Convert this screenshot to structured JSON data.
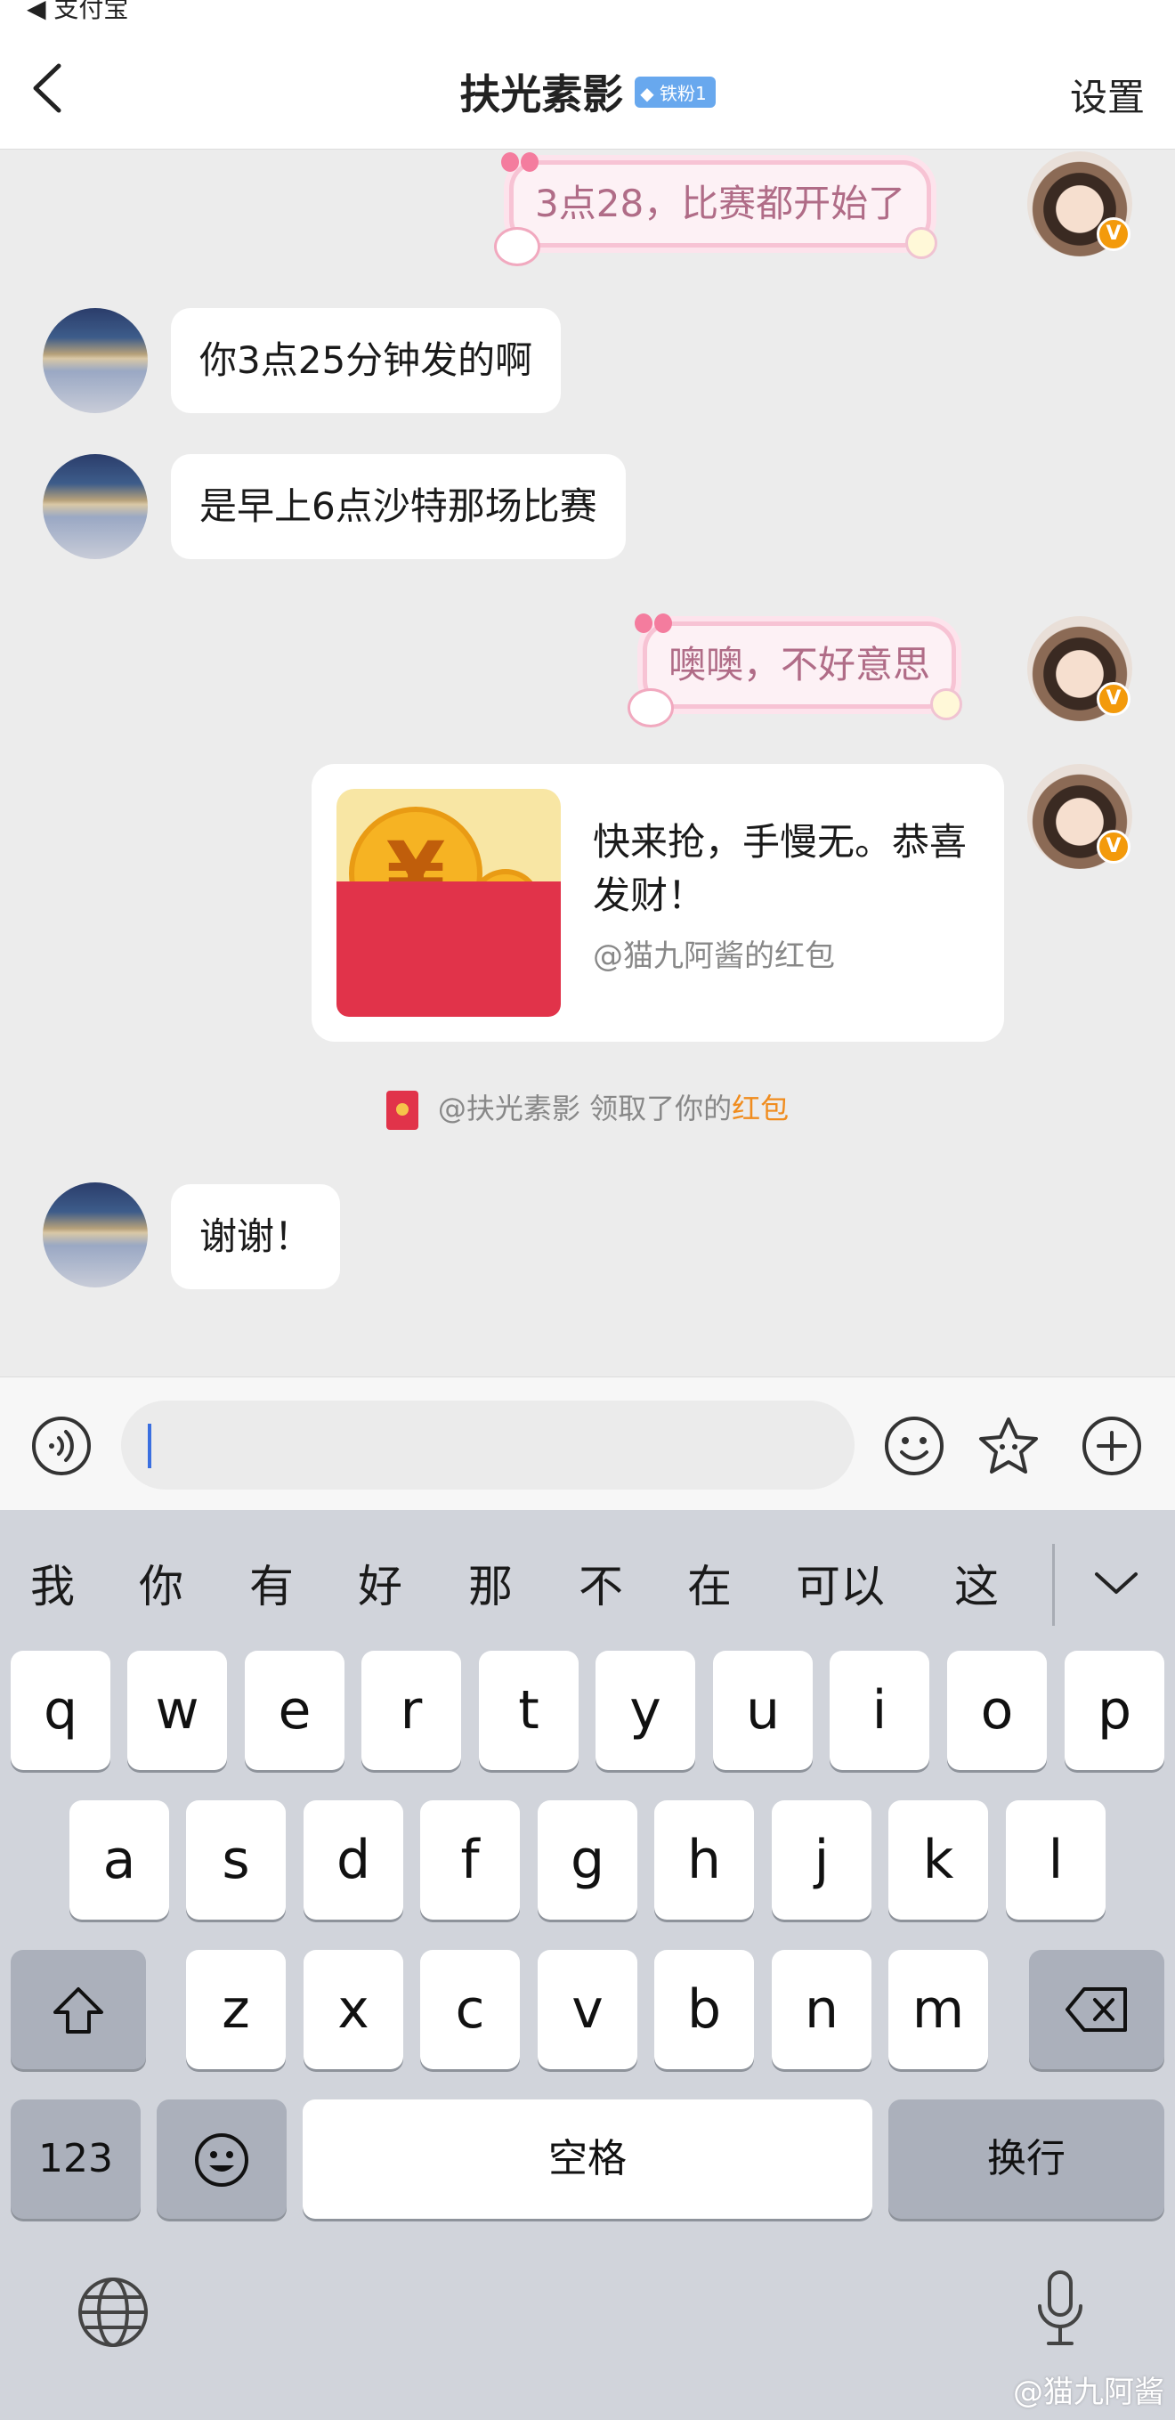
{
  "status": {
    "back_app": "◀ 支付宝"
  },
  "header": {
    "title": "扶光素影",
    "fan_badge": "铁粉1",
    "settings": "设置"
  },
  "messages": {
    "m1": "3点28，比赛都开始了",
    "m2": "你3点25分钟发的啊",
    "m3": "是早上6点沙特那场比赛",
    "m4": "噢噢，不好意思",
    "red_packet": {
      "message": "快来抢，手慢无。恭喜发财！",
      "from": "@猫九阿酱的红包",
      "coin_big": "¥",
      "coin_small": "¥"
    },
    "notice": {
      "text": "@扶光素影 领取了你的",
      "link": "红包"
    },
    "m5": "谢谢！"
  },
  "badges": {
    "verified": "V"
  },
  "keyboard": {
    "candidates": [
      "我",
      "你",
      "有",
      "好",
      "那",
      "不",
      "在",
      "可以",
      "这"
    ],
    "row1": [
      "q",
      "w",
      "e",
      "r",
      "t",
      "y",
      "u",
      "i",
      "o",
      "p"
    ],
    "row2": [
      "a",
      "s",
      "d",
      "f",
      "g",
      "h",
      "j",
      "k",
      "l"
    ],
    "row3": [
      "z",
      "x",
      "c",
      "v",
      "b",
      "n",
      "m"
    ],
    "num_key": "123",
    "space": "空格",
    "return": "换行"
  },
  "watermark": "@猫九阿酱",
  "colors": {
    "accent_orange": "#f08c1e",
    "red_packet": "#e1334a",
    "caret": "#3a6fe0"
  },
  "icons": [
    "back-icon",
    "voice-icon",
    "emoji-icon",
    "sticker-icon",
    "plus-icon",
    "shift-icon",
    "delete-icon",
    "emoji-key-icon",
    "globe-icon",
    "mic-icon",
    "collapse-icon"
  ]
}
